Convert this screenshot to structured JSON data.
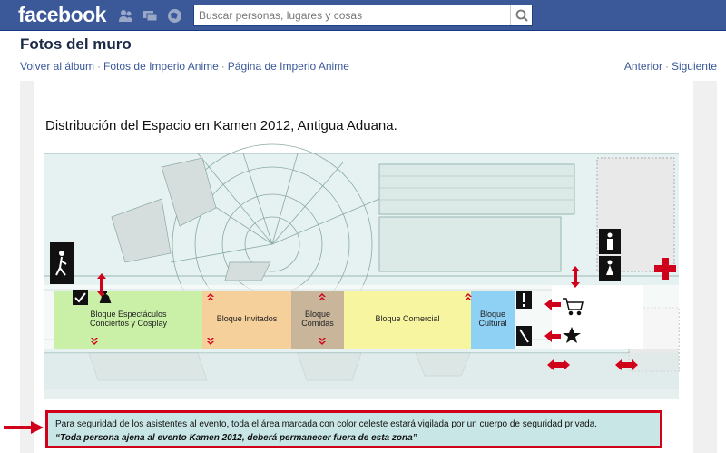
{
  "topbar": {
    "logo": "facebook",
    "search_placeholder": "Buscar personas, lugares y cosas",
    "icons": [
      "friends-icon",
      "messages-icon",
      "notifications-icon",
      "search-icon"
    ]
  },
  "page": {
    "title": "Fotos del muro",
    "nav_left": [
      "Volver al álbum",
      "Fotos de Imperio Anime",
      "Página de Imperio Anime"
    ],
    "nav_right": [
      "Anterior",
      "Siguiente"
    ]
  },
  "photo": {
    "title": "Distribución del Espacio en Kamen 2012, Antigua Aduana.",
    "blocks": {
      "espectaculos_line1": "Bloque Espectáculos",
      "espectaculos_line2": "Conciertos y Cosplay",
      "invitados": "Bloque Invitados",
      "comidas_line1": "Bloque",
      "comidas_line2": "Comidas",
      "comercial": "Bloque Comercial",
      "cultural_line1": "Bloque",
      "cultural_line2": "Cultural"
    },
    "notice_line1": "Para seguridad de los asistentes al evento, toda el área marcada con color celeste estará vigilada por un cuerpo de seguridad privada.",
    "notice_line2": "“Toda persona ajena al evento Kamen 2012, deberá permanecer fuera de esta zona”"
  },
  "colors": {
    "fb_blue": "#3b5998",
    "espectaculos": "#c9f0a6",
    "invitados": "#f6d09a",
    "comidas": "#c8b59a",
    "comercial": "#f7f5a0",
    "cultural": "#8fd0f5",
    "security_zone": "#c8e6e6",
    "alert_red": "#d0021b"
  }
}
